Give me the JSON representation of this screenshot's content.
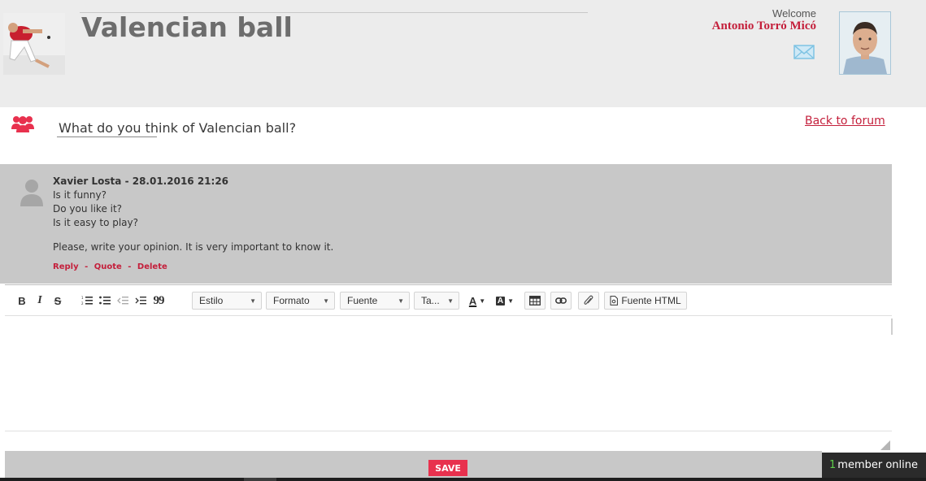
{
  "header": {
    "title": "Valencian ball",
    "welcome": "Welcome",
    "user_name": "Antonio Torró Micó"
  },
  "topic": {
    "title": "What do you think of Valencian ball?",
    "back_link": "Back to forum"
  },
  "post": {
    "meta": "Xavier Losta - 28.01.2016 21:26",
    "lines": [
      "Is it funny?",
      "Do you like it?",
      "Is it easy to play?"
    ],
    "paragraph": "Please, write your opinion. It is very important to know it.",
    "actions": {
      "reply": "Reply",
      "quote": "Quote",
      "delete": "Delete",
      "separator": "-"
    }
  },
  "toolbar": {
    "bold": "B",
    "italic": "I",
    "strike": "S",
    "blockquote": "99",
    "style": "Estilo",
    "format": "Formato",
    "font": "Fuente",
    "size": "Ta...",
    "text_color": "A",
    "bg_color": "A",
    "source": "Fuente HTML"
  },
  "icons": {
    "group": "group-icon",
    "mail": "envelope-icon",
    "post_avatar": "user-silhouette-icon",
    "list_ordered": "ordered-list-icon",
    "list_bulleted": "bulleted-list-icon",
    "outdent": "outdent-icon",
    "indent": "indent-icon",
    "table": "table-icon",
    "link": "link-icon",
    "attach": "paperclip-icon",
    "source": "document-icon"
  },
  "footer": {
    "save": "SAVE",
    "online_count": "1",
    "online_label": "member online"
  },
  "colors": {
    "accent": "#c41f3b",
    "save": "#e8314e",
    "header_bg": "#ececec",
    "post_bg": "#c8c8c8",
    "online_count": "#5fcf4a"
  }
}
